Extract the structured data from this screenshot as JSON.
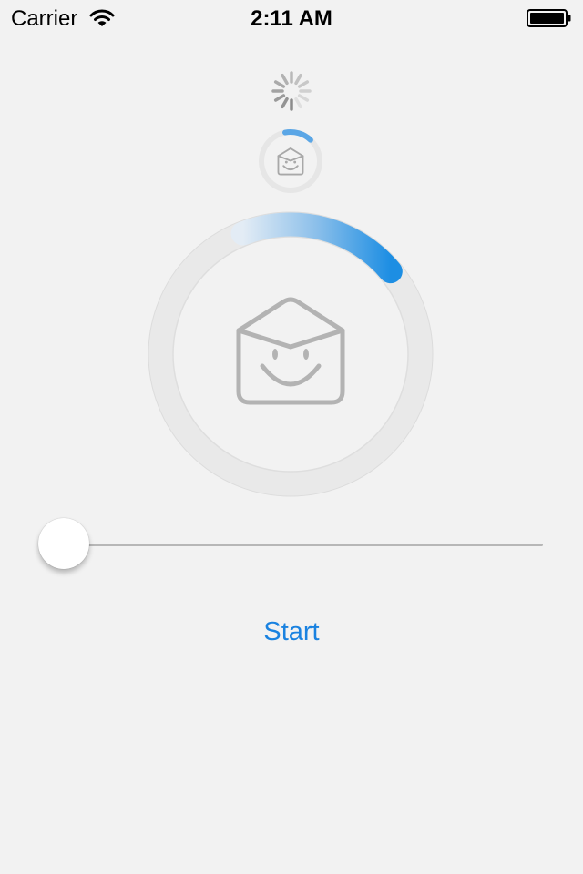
{
  "status_bar": {
    "carrier": "Carrier",
    "time": "2:11 AM"
  },
  "icons": {
    "wifi": "wifi-icon",
    "battery": "battery-icon",
    "spinner": "activity-spinner-icon",
    "mailbox": "smiling-envelope-icon"
  },
  "small_progress": {
    "value": 0.12
  },
  "large_progress": {
    "value": 0.14
  },
  "slider": {
    "value": 0
  },
  "start_button": {
    "label": "Start"
  },
  "colors": {
    "background": "#f2f2f2",
    "accent": "#1a82e0",
    "progress_start": "#d6e6f5",
    "progress_end": "#1d8ee3",
    "ring_track": "#e8e8e8",
    "icon_gray": "#b3b3b3"
  }
}
